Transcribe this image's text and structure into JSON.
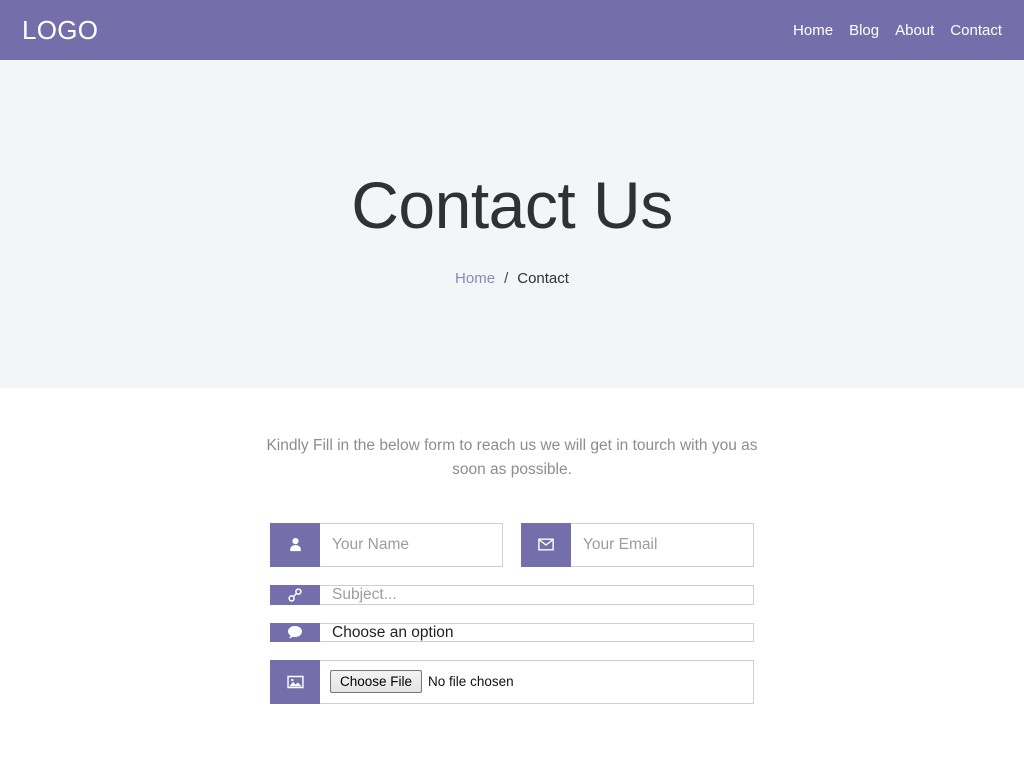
{
  "theme": {
    "brand_purple": "#746fab",
    "hero_bg": "#f4f5f7",
    "page_bg": "#ffffff",
    "heading_color": "#2e3135",
    "muted_text": "#8a8d92",
    "link_color": "#8b87bb",
    "border_color": "#ccd0d4"
  },
  "navbar": {
    "brand": "LOGO",
    "links": [
      {
        "label": "Home",
        "name": "nav-link-home"
      },
      {
        "label": "Blog",
        "name": "nav-link-blog"
      },
      {
        "label": "About",
        "name": "nav-link-about"
      },
      {
        "label": "Contact",
        "name": "nav-link-contact"
      }
    ]
  },
  "hero": {
    "title": "Contact Us",
    "breadcrumb": {
      "home": "Home",
      "separator": "/",
      "current": "Contact"
    }
  },
  "main": {
    "intro": "Kindly Fill in the below form to reach us we will get in tourch with you as soon as possible.",
    "form": {
      "name_field": {
        "placeholder": "Your Name",
        "icon": "user-icon"
      },
      "email_field": {
        "placeholder": "Your Email",
        "icon": "envelope-icon"
      },
      "subject_field": {
        "placeholder": "Subject...",
        "icon": "link-icon"
      },
      "option_select": {
        "selected": "Choose an option",
        "icon": "comment-icon",
        "options": [
          "Choose an option"
        ]
      },
      "file_field": {
        "button_label": "Choose File",
        "status": "No file chosen",
        "icon": "image-icon"
      }
    }
  }
}
